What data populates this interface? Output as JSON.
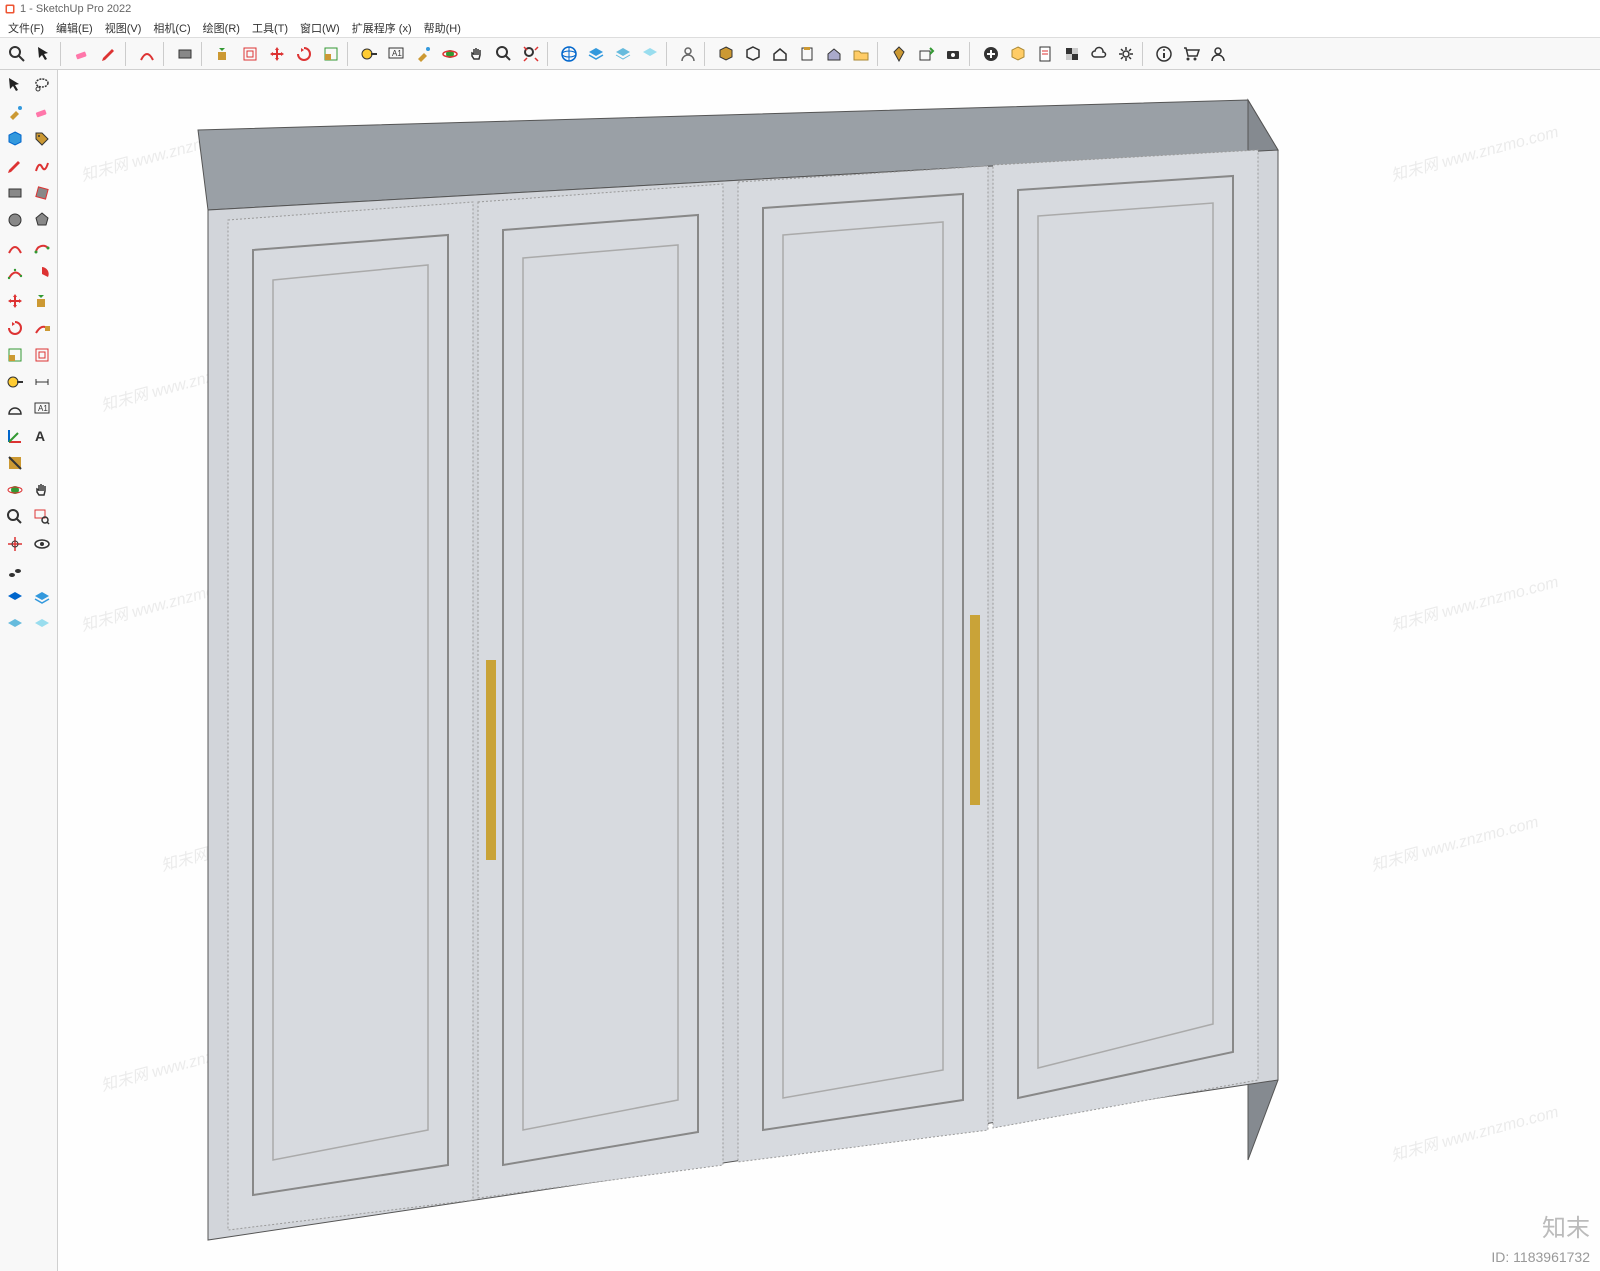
{
  "title": "1 - SketchUp Pro 2022",
  "menus": [
    "文件(F)",
    "编辑(E)",
    "视图(V)",
    "相机(C)",
    "绘图(R)",
    "工具(T)",
    "窗口(W)",
    "扩展程序 (x)",
    "帮助(H)"
  ],
  "top_toolbar": [
    {
      "name": "search-icon"
    },
    {
      "name": "select-icon"
    },
    {
      "name": "sep"
    },
    {
      "name": "eraser-icon"
    },
    {
      "name": "line-pencil-icon"
    },
    {
      "name": "sep"
    },
    {
      "name": "arc-icon"
    },
    {
      "name": "sep"
    },
    {
      "name": "rect-icon"
    },
    {
      "name": "sep"
    },
    {
      "name": "pushpull-icon"
    },
    {
      "name": "offset-icon"
    },
    {
      "name": "move-icon"
    },
    {
      "name": "rotate-icon"
    },
    {
      "name": "scale-icon"
    },
    {
      "name": "sep"
    },
    {
      "name": "tape-icon"
    },
    {
      "name": "text-icon"
    },
    {
      "name": "paint-icon"
    },
    {
      "name": "orbit-icon"
    },
    {
      "name": "pan-icon"
    },
    {
      "name": "zoom-icon"
    },
    {
      "name": "zoomext-icon"
    },
    {
      "name": "sep"
    },
    {
      "name": "globe-icon"
    },
    {
      "name": "layers1-icon"
    },
    {
      "name": "layers2-icon"
    },
    {
      "name": "layers3-icon"
    },
    {
      "name": "sep"
    },
    {
      "name": "avatar-icon"
    },
    {
      "name": "sep"
    },
    {
      "name": "cube1-icon"
    },
    {
      "name": "cube2-icon"
    },
    {
      "name": "house1-icon"
    },
    {
      "name": "clipboard-icon"
    },
    {
      "name": "house2-icon"
    },
    {
      "name": "open-icon"
    },
    {
      "name": "sep"
    },
    {
      "name": "diamond-icon"
    },
    {
      "name": "export-icon"
    },
    {
      "name": "camera-icon"
    },
    {
      "name": "sep"
    },
    {
      "name": "plus-icon"
    },
    {
      "name": "package-icon"
    },
    {
      "name": "doc-icon"
    },
    {
      "name": "checker-icon"
    },
    {
      "name": "cloud-icon"
    },
    {
      "name": "gear-icon"
    },
    {
      "name": "sep"
    },
    {
      "name": "info-icon"
    },
    {
      "name": "cart-icon"
    },
    {
      "name": "user-icon"
    }
  ],
  "left_toolbar_pairs": [
    [
      "cursor-icon",
      "lasso-icon"
    ],
    [
      "paintbucket-icon",
      "eraser2-icon"
    ],
    [
      "component-icon",
      "tag-icon"
    ],
    [
      "pencil-icon",
      "freehand-icon"
    ],
    [
      "rectangle-icon",
      "rotrect-icon"
    ],
    [
      "circle-icon",
      "polygon-icon"
    ],
    [
      "arc2-icon",
      "arc2pt-icon"
    ],
    [
      "arc3pt-icon",
      "pie-icon"
    ],
    [
      "move2-icon",
      "pushpull2-icon"
    ],
    [
      "rotate2-icon",
      "followme-icon"
    ],
    [
      "scale2-icon",
      "offset2-icon"
    ],
    [
      "tape2-icon",
      "dimension-icon"
    ],
    [
      "protractor-icon",
      "label-icon"
    ],
    [
      "axes-icon",
      "text3d-icon"
    ],
    [
      "section-icon",
      ""
    ],
    [
      "orbit2-icon",
      "pan2-icon"
    ],
    [
      "zoom2-icon",
      "zoomwin-icon"
    ],
    [
      "position-icon",
      "look-icon"
    ],
    [
      "walk-icon",
      ""
    ],
    [
      "layer-a-icon",
      "layer-b-icon"
    ],
    [
      "layer-c-icon",
      "layer-d-icon"
    ]
  ],
  "watermark": {
    "brand": "知末",
    "id_label": "ID:",
    "id": "1183961732",
    "diag": "知末网 www.znzmo.com"
  }
}
